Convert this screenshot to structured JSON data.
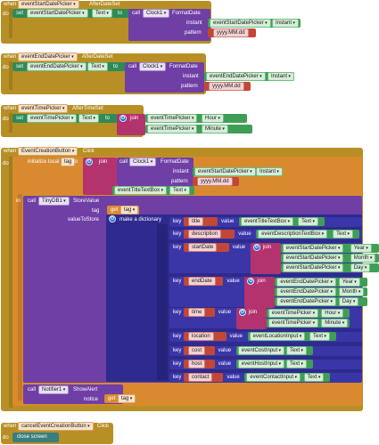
{
  "keywords": {
    "when": "when",
    "do": "do",
    "set": "set",
    "to": "to",
    "call": "call",
    "in": "in",
    "instant": "instant",
    "pattern": "pattern",
    "join": "join",
    "tag": "tag",
    "valueToStore": "valueToStore",
    "key": "key",
    "value": "value",
    "notice": "notice",
    "get": "get"
  },
  "block1": {
    "component": "eventStartDatePicker",
    "event": "AfterDateSet",
    "prop_comp": "eventStartDatePicker",
    "prop": "Text",
    "clock": "Clock1",
    "method": "FormatDate",
    "instant_comp": "eventStartDatePicker",
    "instant_prop": "Instant",
    "pattern": "yyyy.MM.dd"
  },
  "block2": {
    "component": "eventEndDatePicker",
    "event": "AfterDateSet",
    "prop_comp": "eventEndDatePicker",
    "prop": "Text",
    "clock": "Clock1",
    "method": "FormatDate",
    "instant_comp": "eventEndDatePicker",
    "instant_prop": "Instant",
    "pattern": "yyyy.MM.dd"
  },
  "block3": {
    "component": "eventTimePicker",
    "event": "AfterTimeSet",
    "prop_comp": "eventTimePicker",
    "prop": "Text",
    "j1_comp": "eventTimePicker",
    "j1_prop": "Hour",
    "j2_comp": "eventTimePicker",
    "j2_prop": "Minute"
  },
  "block4": {
    "component": "EventCreationButton",
    "event": "Click",
    "init_label": "initialize local",
    "var": "tag",
    "clock": "Clock1",
    "method": "FormatDate",
    "instant_comp": "eventStartDatePicker",
    "instant_prop": "Instant",
    "pattern": "yyyy.MM.dd",
    "title_comp": "eventTitleTextBox",
    "title_prop": "Text",
    "db": "TinyDB1",
    "db_method": "StoreValue",
    "make_dict": "make a dictionary",
    "rows": [
      {
        "key": "title",
        "comp": "eventTitleTextBox",
        "prop": "Text"
      },
      {
        "key": "description",
        "comp": "eventDescriptionTextBox",
        "prop": "Text"
      },
      {
        "key": "startDate",
        "j": [
          {
            "comp": "eventStartDatePicker",
            "prop": "Year"
          },
          {
            "comp": "eventStartDatePicker",
            "prop": "Month"
          },
          {
            "comp": "eventStartDatePicker",
            "prop": "Day"
          }
        ]
      },
      {
        "key": "endDate",
        "j": [
          {
            "comp": "eventEndDatePicker",
            "prop": "Year"
          },
          {
            "comp": "eventEndDatePicker",
            "prop": "Month"
          },
          {
            "comp": "eventEndDatePicker",
            "prop": "Day"
          }
        ]
      },
      {
        "key": "time",
        "j": [
          {
            "comp": "eventTimePicker",
            "prop": "Hour"
          },
          {
            "comp": "eventTimePicker",
            "prop": "Minute"
          }
        ]
      },
      {
        "key": "location",
        "comp": "eventLocationInput",
        "prop": "Text"
      },
      {
        "key": "cost",
        "comp": "eventCostInput",
        "prop": "Text"
      },
      {
        "key": "host",
        "comp": "eventHostInput",
        "prop": "Text"
      },
      {
        "key": "contact",
        "comp": "eventContactInput",
        "prop": "Text"
      }
    ],
    "notifier": "Notifier1",
    "notifier_method": "ShowAlert",
    "notice_var": "tag"
  },
  "block5": {
    "component": "cancelEventCreationButton",
    "event": "Click",
    "action": "close screen"
  }
}
